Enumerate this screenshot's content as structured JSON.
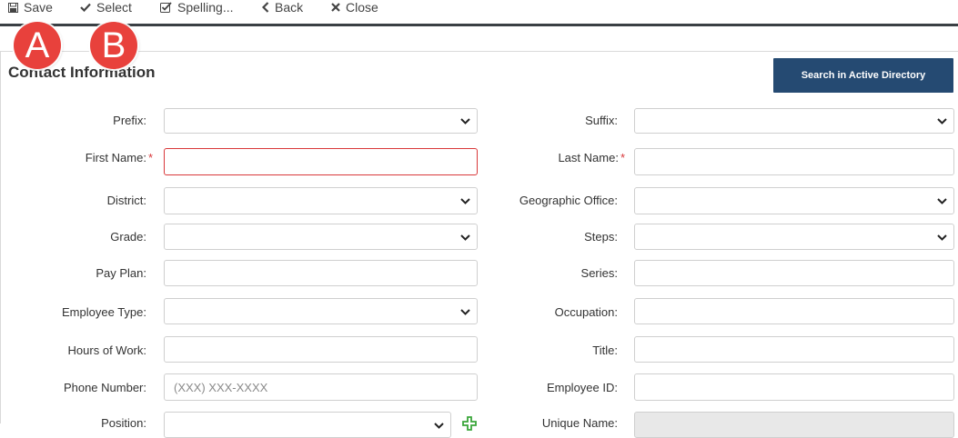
{
  "toolbar": {
    "save": "Save",
    "select": "Select",
    "spelling": "Spelling...",
    "back": "Back",
    "close": "Close"
  },
  "callouts": {
    "a": "A",
    "b": "B"
  },
  "section": {
    "title": "Contact Information"
  },
  "search_ad_button": "Search in Active Directory",
  "form": {
    "prefix": "Prefix:",
    "suffix": "Suffix:",
    "first_name": "First Name:",
    "last_name": "Last Name:",
    "required_marker": "*",
    "district": "District:",
    "geographic_office": "Geographic Office:",
    "grade": "Grade:",
    "steps": "Steps:",
    "pay_plan": "Pay Plan:",
    "series": "Series:",
    "employee_type": "Employee Type:",
    "occupation": "Occupation:",
    "hours_of_work": "Hours of Work:",
    "title": "Title:",
    "phone_number": "Phone Number:",
    "phone_placeholder": "(XXX) XXX-XXXX",
    "employee_id": "Employee ID:",
    "position": "Position:",
    "unique_name": "Unique Name:"
  },
  "colors": {
    "primary_button": "#254a72",
    "callout": "#e8413c",
    "required": "#d9383a",
    "add_icon": "#3aa63a"
  },
  "icons": {
    "save": "floppy-disk-icon",
    "select": "checkmark-icon",
    "spelling": "checkbox-icon",
    "back": "chevron-left-icon",
    "close": "x-icon",
    "dropdown": "chevron-down-icon",
    "add": "plus-icon"
  }
}
